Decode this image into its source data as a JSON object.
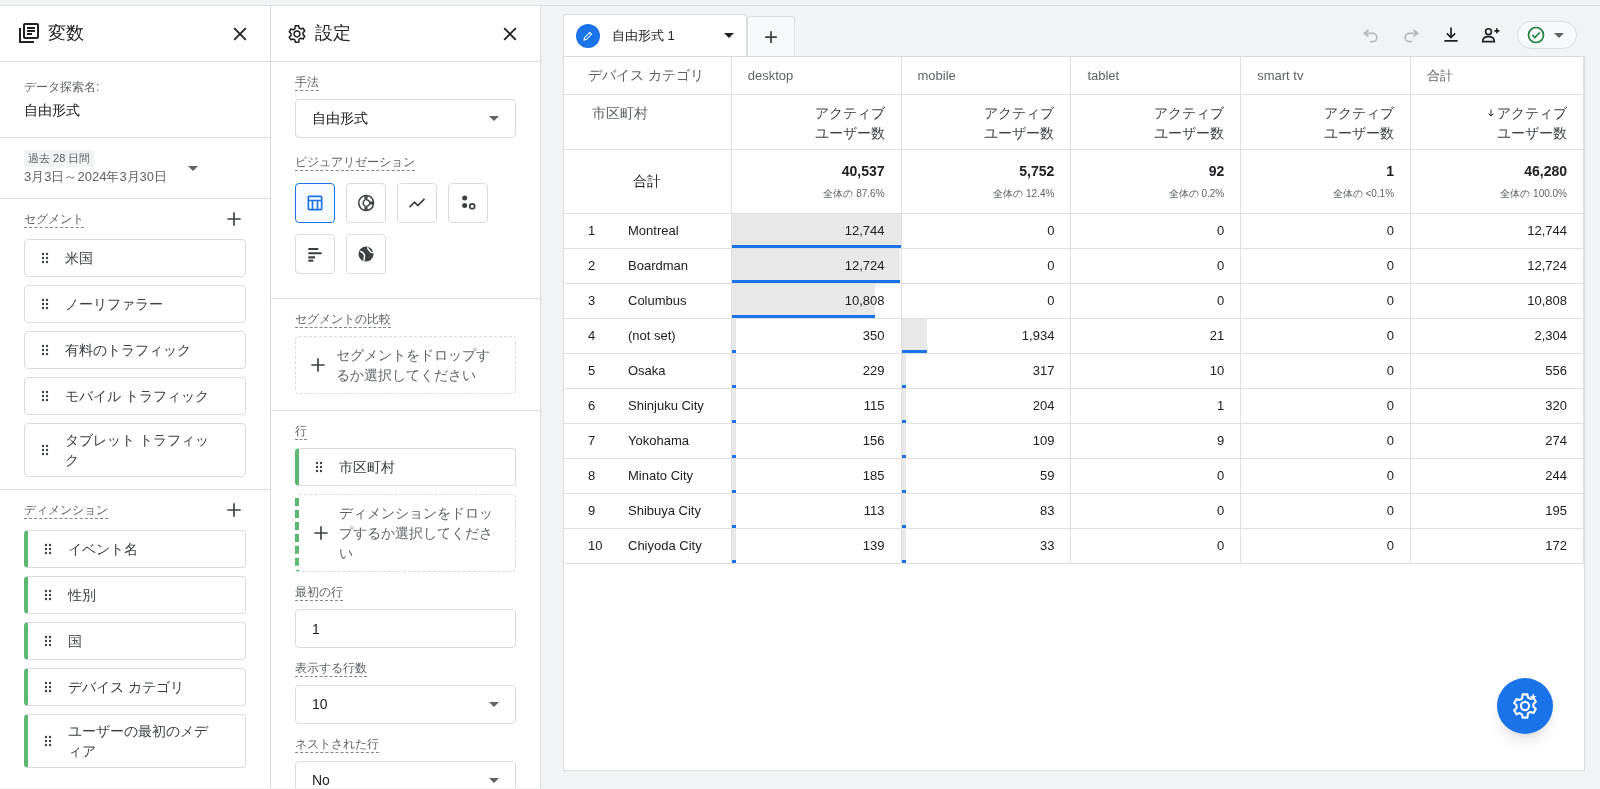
{
  "variables_panel": {
    "title": "変数",
    "exploration_name_label": "データ探索名:",
    "exploration_name": "自由形式",
    "date_range": {
      "badge": "過去 28 日間",
      "range": "3月3日～2024年3月30日"
    },
    "segments": {
      "label": "セグメント",
      "items": [
        "米国",
        "ノーリファラー",
        "有料のトラフィック",
        "モバイル トラフィック",
        "タブレット トラフィック"
      ]
    },
    "dimensions": {
      "label": "ディメンション",
      "items": [
        "イベント名",
        "性別",
        "国",
        "デバイス カテゴリ",
        "ユーザーの最初のメディア"
      ]
    }
  },
  "settings_panel": {
    "title": "設定",
    "technique": {
      "label": "手法",
      "value": "自由形式"
    },
    "visualization": {
      "label": "ビジュアリゼーション",
      "options": [
        {
          "kind": "table",
          "selected": true
        },
        {
          "kind": "donut",
          "selected": false
        },
        {
          "kind": "line",
          "selected": false
        },
        {
          "kind": "scatter",
          "selected": false
        },
        {
          "kind": "bar",
          "selected": false
        },
        {
          "kind": "map",
          "selected": false
        }
      ]
    },
    "segment_comparison": {
      "label": "セグメントの比較",
      "placeholder": "セグメントをドロップするか選択してください"
    },
    "rows": {
      "label": "行",
      "items": [
        "市区町村"
      ],
      "placeholder": "ディメンションをドロップするか選択してください"
    },
    "first_row": {
      "label": "最初の行",
      "value": "1"
    },
    "rows_shown": {
      "label": "表示する行数",
      "value": "10"
    },
    "nested_rows": {
      "label": "ネストされた行",
      "value": "No"
    }
  },
  "tabs": [
    {
      "label": "自由形式 1",
      "selected": true
    }
  ],
  "add_tab": "+",
  "table": {
    "pivot_label": "デバイス カテゴリ",
    "row_label": "市区町村",
    "columns": [
      {
        "label": "desktop",
        "metric": "アクティブユーザー数",
        "sorted": false
      },
      {
        "label": "mobile",
        "metric": "アクティブユーザー数",
        "sorted": false
      },
      {
        "label": "tablet",
        "metric": "アクティブユーザー数",
        "sorted": false
      },
      {
        "label": "smart tv",
        "metric": "アクティブユーザー数",
        "sorted": false
      },
      {
        "label": "合計",
        "metric": "アクティブユーザー数",
        "sorted": true
      }
    ],
    "totals": {
      "label": "合計",
      "values": [
        {
          "value": "40,537",
          "share": "全体の 87.6%"
        },
        {
          "value": "5,752",
          "share": "全体の 12.4%"
        },
        {
          "value": "92",
          "share": "全体の 0.2%"
        },
        {
          "value": "1",
          "share": "全体の <0.1%"
        },
        {
          "value": "46,280",
          "share": "全体の 100.0%"
        }
      ]
    },
    "rows": [
      {
        "index": "1",
        "city": "Montreal",
        "cells": [
          {
            "value": "12,744",
            "level": 1
          },
          {
            "value": "0"
          },
          {
            "value": "0"
          },
          {
            "value": "0"
          }
        ],
        "total": "12,744"
      },
      {
        "index": "2",
        "city": "Boardman",
        "cells": [
          {
            "value": "12,724",
            "level": 0.998
          },
          {
            "value": "0"
          },
          {
            "value": "0"
          },
          {
            "value": "0"
          }
        ],
        "total": "12,724"
      },
      {
        "index": "3",
        "city": "Columbus",
        "cells": [
          {
            "value": "10,808",
            "level": 0.848
          },
          {
            "value": "0"
          },
          {
            "value": "0"
          },
          {
            "value": "0"
          }
        ],
        "total": "10,808"
      },
      {
        "index": "4",
        "city": "(not set)",
        "cells": [
          {
            "value": "350",
            "level": 0.027
          },
          {
            "value": "1,934",
            "level": 0.152
          },
          {
            "value": "21"
          },
          {
            "value": "0"
          }
        ],
        "total": "2,304"
      },
      {
        "index": "5",
        "city": "Osaka",
        "cells": [
          {
            "value": "229",
            "level": 0.018
          },
          {
            "value": "317",
            "level": 0.025
          },
          {
            "value": "10"
          },
          {
            "value": "0"
          }
        ],
        "total": "556"
      },
      {
        "index": "6",
        "city": "Shinjuku City",
        "cells": [
          {
            "value": "115",
            "level": 0.009
          },
          {
            "value": "204",
            "level": 0.016
          },
          {
            "value": "1"
          },
          {
            "value": "0"
          }
        ],
        "total": "320"
      },
      {
        "index": "7",
        "city": "Yokohama",
        "cells": [
          {
            "value": "156",
            "level": 0.012
          },
          {
            "value": "109",
            "level": 0.009
          },
          {
            "value": "9"
          },
          {
            "value": "0"
          }
        ],
        "total": "274"
      },
      {
        "index": "8",
        "city": "Minato City",
        "cells": [
          {
            "value": "185",
            "level": 0.015
          },
          {
            "value": "59",
            "level": 0.005
          },
          {
            "value": "0"
          },
          {
            "value": "0"
          }
        ],
        "total": "244"
      },
      {
        "index": "9",
        "city": "Shibuya City",
        "cells": [
          {
            "value": "113",
            "level": 0.009
          },
          {
            "value": "83",
            "level": 0.007
          },
          {
            "value": "0"
          },
          {
            "value": "0"
          }
        ],
        "total": "195"
      },
      {
        "index": "10",
        "city": "Chiyoda City",
        "cells": [
          {
            "value": "139",
            "level": 0.011
          },
          {
            "value": "33",
            "level": 0.003
          },
          {
            "value": "0"
          },
          {
            "value": "0"
          }
        ],
        "total": "172"
      }
    ]
  },
  "toolbar": {
    "undo_disabled": true,
    "redo_disabled": true
  }
}
